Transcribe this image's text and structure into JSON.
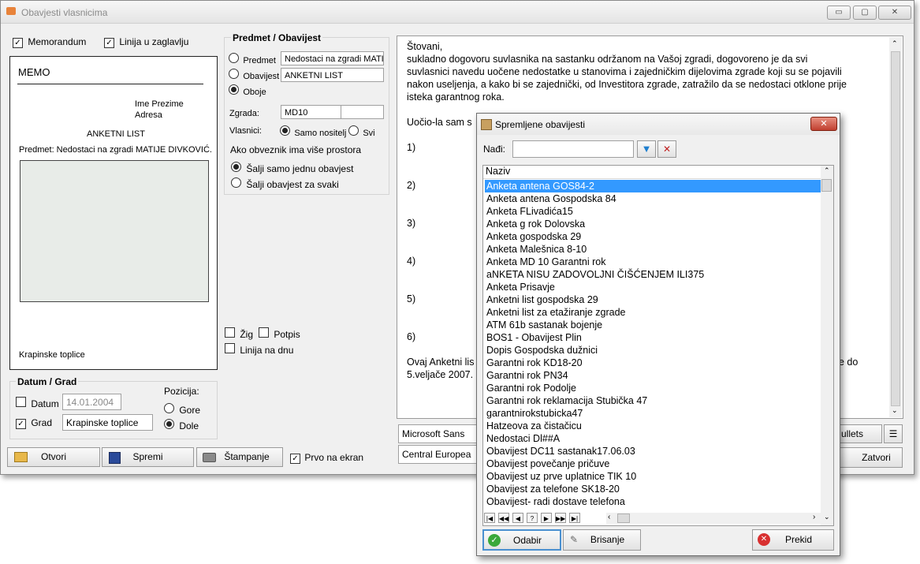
{
  "window": {
    "title": "Obavjesti vlasnicima",
    "controls": {
      "minimize": "▭",
      "maximize": "▢",
      "close": "✕"
    }
  },
  "options": {
    "memorandum": {
      "label": "Memorandum",
      "checked": true
    },
    "header_line": {
      "label": "Linija u zaglavlju",
      "checked": true
    }
  },
  "memo": {
    "title": "MEMO",
    "name_line": "Ime Prezime",
    "address_line": "Adresa",
    "doc_title": "ANKETNI LIST",
    "subject_line": "Predmet: Nedostaci na zgradi MATIJE DIVKOVIĆ.",
    "place": "Krapinske toplice"
  },
  "subject_group": {
    "title": "Predmet / Obavijest",
    "predmet_label": "Predmet",
    "predmet_value": "Nedostaci na zgradi MATI",
    "obavijest_label": "Obavijest",
    "obavijest_value": "ANKETNI LIST",
    "oboje_label": "Oboje",
    "selected": "oboje",
    "zgrada_label": "Zgrada:",
    "zgrada_value": "MD10",
    "zgrada_extra": "",
    "vlasnici_label": "Vlasnici:",
    "samo_nositelj": "Samo nositelj",
    "svi": "Svi",
    "multi_label": "Ako obveznik ima više prostora",
    "send_one": "Šalji samo jednu obavjest",
    "send_each": "Šalji obavjest za svaki"
  },
  "stamp_opts": {
    "zig": "Žig",
    "potpis": "Potpis",
    "linija_dnu": "Linija na dnu"
  },
  "datum_grad": {
    "title": "Datum / Grad",
    "datum_label": "Datum",
    "datum_value": "14.01.2004",
    "grad_label": "Grad",
    "grad_value": "Krapinske toplice",
    "pozicija_label": "Pozicija:",
    "gore": "Gore",
    "dole": "Dole"
  },
  "buttons": {
    "otvori": "Otvori",
    "spremi": "Spremi",
    "stampanje": "Štampanje",
    "prvo_na_ekran": "Prvo na ekran",
    "zatvori": "Zatvori"
  },
  "letter": {
    "line1": "Štovani,",
    "line2": "sukladno dogovoru suvlasnika na sastanku održanom na Vašoj zgradi, dogovoreno je da svi",
    "line3": "suvlasnici navedu uočene nedostatke u stanovima i zajedničkim dijelovima zgrade koji su se pojavili",
    "line4": "nakon useljenja, a kako bi se zajednički, od Investitora zgrade, zatražilo da se nedostaci otklone prije",
    "line5": "isteka  garantnog roka.",
    "line6": "Uočio-la sam s",
    "items": [
      "1)",
      "2)",
      "3)",
      "4)",
      "5)",
      "6)"
    ],
    "closing1a": "Ovaj Anketni lis",
    "closing1b": "e do",
    "closing2": "5.veljače 2007."
  },
  "format_bar": {
    "font_name": "Microsoft Sans",
    "charset": "Central Europea",
    "bullets": "ullets"
  },
  "dialog": {
    "title": "Spremljene obavijesti",
    "find_label": "Nađi:",
    "find_value": "",
    "column_header": "Naziv",
    "items": [
      "Anketa antena GOS84-2",
      "Anketa antena Gospodska 84",
      "Anketa FLivadića15",
      "Anketa g rok Dolovska",
      "Anketa gospodska 29",
      "Anketa Malešnica 8-10",
      "Anketa MD 10 Garantni rok",
      "aNKETA NISU ZADOVOLJNI ČIŠĆENJEM ILI375",
      "Anketa Prisavje",
      "Anketni list gospodska 29",
      "Anketni list za etažiranje zgrade",
      "ATM 61b sastanak bojenje",
      "BOS1 - Obavijest Plin",
      "Dopis Gospodska dužnici",
      "Garantni rok KD18-20",
      "Garantni rok PN34",
      "Garantni rok Podolje",
      "Garantni rok reklamacija Stubička 47",
      "garantnirokstubicka47",
      "Hatzeova za čistačicu",
      "Nedostaci Dl##A",
      "Obavijest DC11 sastanak17.06.03",
      "Obavijest povečanje pričuve",
      "Obavijest uz prve uplatnice TIK 10",
      "Obavijest za telefone SK18-20",
      "Obavijest- radi dostave telefona"
    ],
    "selected_index": 0,
    "nav_buttons": [
      "|◀",
      "◀◀",
      "◀",
      "?",
      "▶",
      "▶▶",
      "▶|"
    ],
    "odabir": "Odabir",
    "brisanje": "Brisanje",
    "prekid": "Prekid"
  }
}
